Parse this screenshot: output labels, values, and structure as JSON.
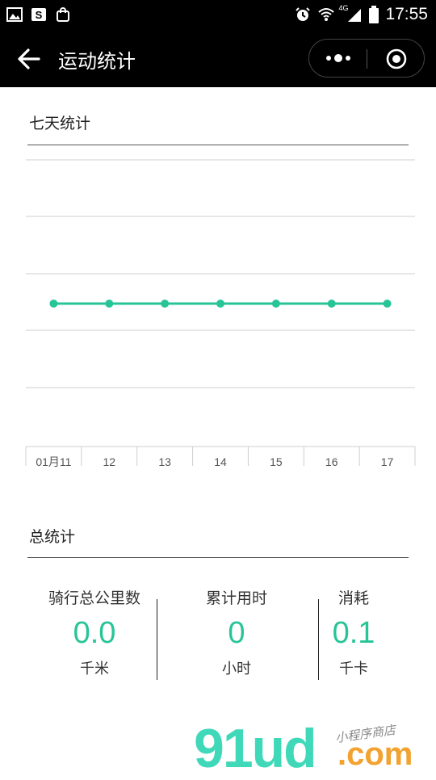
{
  "status_bar": {
    "time": "17:55",
    "network": "4G"
  },
  "nav": {
    "title": "运动统计"
  },
  "weekly": {
    "title": "七天统计"
  },
  "chart_data": {
    "type": "line",
    "categories": [
      "01月11",
      "12",
      "13",
      "14",
      "15",
      "16",
      "17"
    ],
    "values": [
      0,
      0,
      0,
      0,
      0,
      0,
      0
    ],
    "title": "",
    "xlabel": "",
    "ylabel": "",
    "grid": true,
    "line_color": "#27c497"
  },
  "totals": {
    "title": "总统计",
    "items": [
      {
        "label": "骑行总公里数",
        "value": "0.0",
        "unit": "千米"
      },
      {
        "label": "累计用时",
        "value": "0",
        "unit": "小时"
      },
      {
        "label": "消耗",
        "value": "0.1",
        "unit": "千卡"
      }
    ]
  },
  "watermark": {
    "main": "91ud",
    "suffix": ".com",
    "tag": "小程序商店"
  },
  "colors": {
    "accent": "#27c497",
    "bar": "#000000"
  }
}
